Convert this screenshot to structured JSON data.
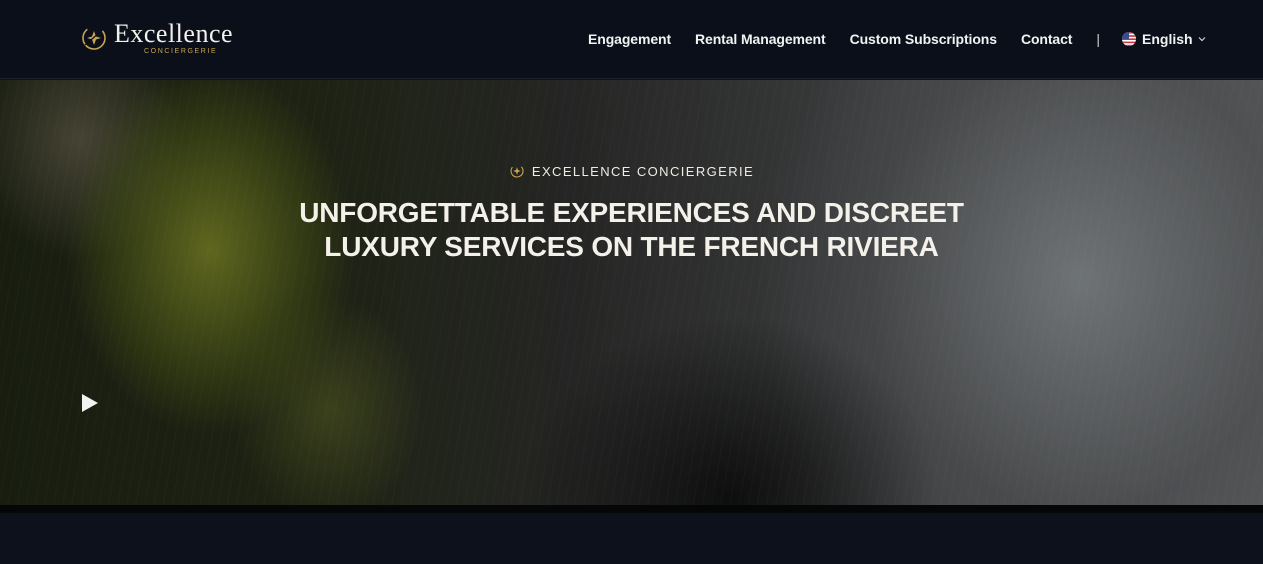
{
  "brand": {
    "name": "Excellence",
    "tagline": "CONCIERGERIE",
    "accent_color": "#c9a452"
  },
  "nav": {
    "items": [
      {
        "label": "Engagement"
      },
      {
        "label": "Rental Management"
      },
      {
        "label": "Custom Subscriptions"
      },
      {
        "label": "Contact"
      }
    ],
    "separator": "|",
    "language": {
      "label": "English",
      "flag_icon": "us-flag-icon",
      "chevron_icon": "chevron-down-icon"
    }
  },
  "hero": {
    "eyebrow": "EXCELLENCE CONCIERGERIE",
    "headline_line1": "UNFORGETTABLE EXPERIENCES AND DISCREET",
    "headline_line2": "LUXURY SERVICES ON THE FRENCH RIVIERA",
    "play_icon": "play-icon"
  }
}
